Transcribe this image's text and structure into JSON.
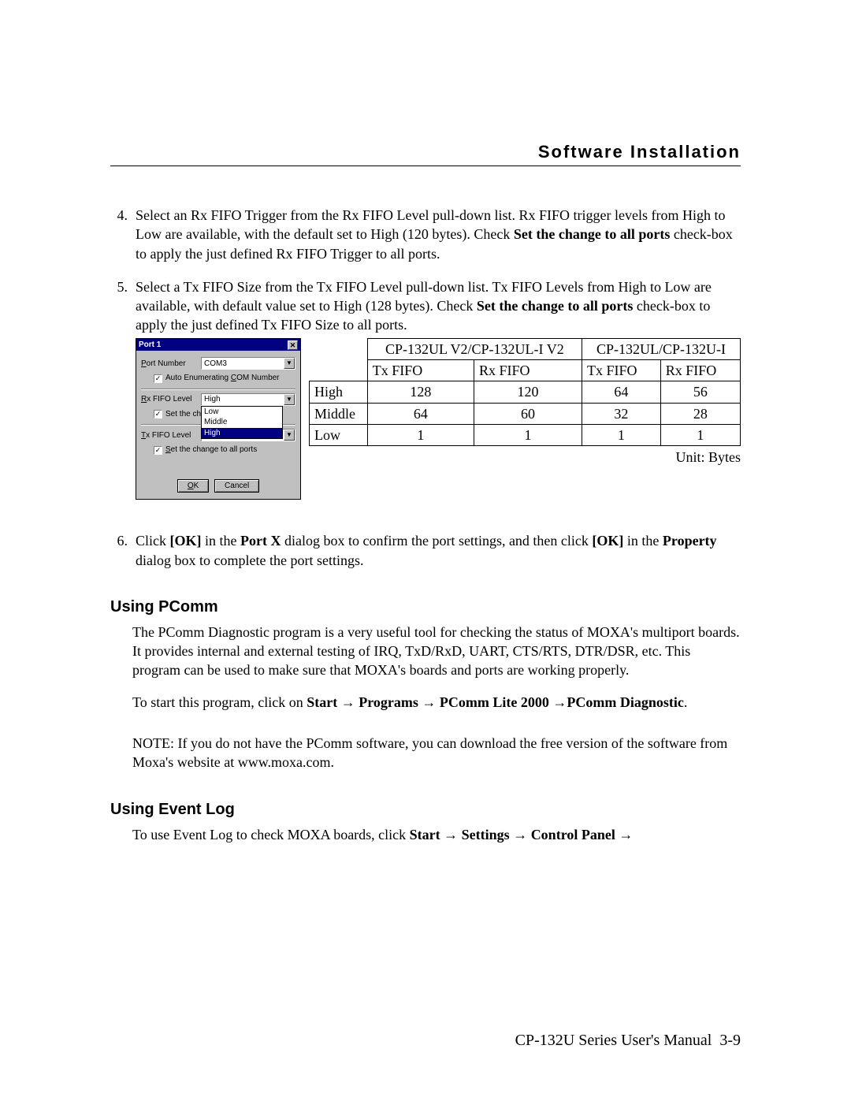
{
  "header": {
    "title": "Software Installation"
  },
  "items": {
    "i4": {
      "num": "4.",
      "t1": "Select an Rx FIFO Trigger from the Rx FIFO Level pull-down list. Rx FIFO trigger levels from High to Low are available, with the default set to High (120 bytes). Check ",
      "b1": "Set the change to all ports",
      "t2": " check-box to apply the just defined Rx FIFO Trigger to all ports."
    },
    "i5": {
      "num": "5.",
      "t1": "Select a Tx FIFO Size from the Tx FIFO Level pull-down list. Tx FIFO Levels from High to Low are available, with default value set to High (128 bytes). Check ",
      "b1": "Set the change to all ports",
      "t2": " check-box to apply the just defined Tx FIFO Size to all ports."
    },
    "i6": {
      "num": "6.",
      "t1": "Click ",
      "b1": "[OK]",
      "t2": " in the ",
      "b2": "Port X",
      "t3": " dialog box to confirm the port settings, and then click ",
      "b3": "[OK]",
      "t4": " in the ",
      "b4": "Property",
      "t5": " dialog box to complete the port settings."
    }
  },
  "dialog": {
    "title": "Port 1",
    "close": "✕",
    "port_label": "Port Number",
    "port_value": "COM3",
    "auto_enum": "Auto Enumerating COM Number",
    "rx_label": "Rx FIFO Level",
    "rx_value": "High",
    "rx_opts": {
      "o0": "Low",
      "o1": "Middle",
      "o2": "High"
    },
    "set_the_ch": "Set the ch",
    "tx_label": "Tx FIFO Level",
    "tx_value": "High",
    "set_all": "Set the change to all ports",
    "ok": "OK",
    "cancel": "Cancel"
  },
  "table": {
    "h1": "CP-132UL V2/CP-132UL-I V2",
    "h2": "CP-132UL/CP-132U-I",
    "sub": {
      "a": "Tx FIFO",
      "b": "Rx FIFO",
      "c": "Tx FIFO",
      "d": "Rx FIFO"
    },
    "r1": {
      "lbl": "High",
      "a": "128",
      "b": "120",
      "c": "64",
      "d": "56"
    },
    "r2": {
      "lbl": "Middle",
      "a": "64",
      "b": "60",
      "c": "32",
      "d": "28"
    },
    "r3": {
      "lbl": "Low",
      "a": "1",
      "b": "1",
      "c": "1",
      "d": "1"
    },
    "unit": "Unit: Bytes"
  },
  "pcomm": {
    "h": "Using PComm",
    "p1": "The PComm Diagnostic program is a very useful tool for checking the status of MOXA's multiport boards. It provides internal and external testing of IRQ, TxD/RxD, UART, CTS/RTS, DTR/DSR, etc. This program can be used to make sure that MOXA's boards and ports are working properly.",
    "p2a": "To start this program, click on ",
    "p2b": "Start",
    "p2c": "Programs",
    "p2d": "PComm Lite 2000",
    "p2e": "PComm Diagnostic",
    "p2f": ".",
    "note": "NOTE: If you do not have the PComm software, you can download the free version of the software from Moxa's website at www.moxa.com."
  },
  "eventlog": {
    "h": "Using Event Log",
    "p1a": "To use Event Log to check MOXA boards, click ",
    "p1b": "Start",
    "p1c": "Settings",
    "p1d": "Control Panel"
  },
  "footer": {
    "t1": "CP-132U Series User's Manual",
    "t2": "3-9"
  },
  "glyph": {
    "arrow": "→"
  }
}
